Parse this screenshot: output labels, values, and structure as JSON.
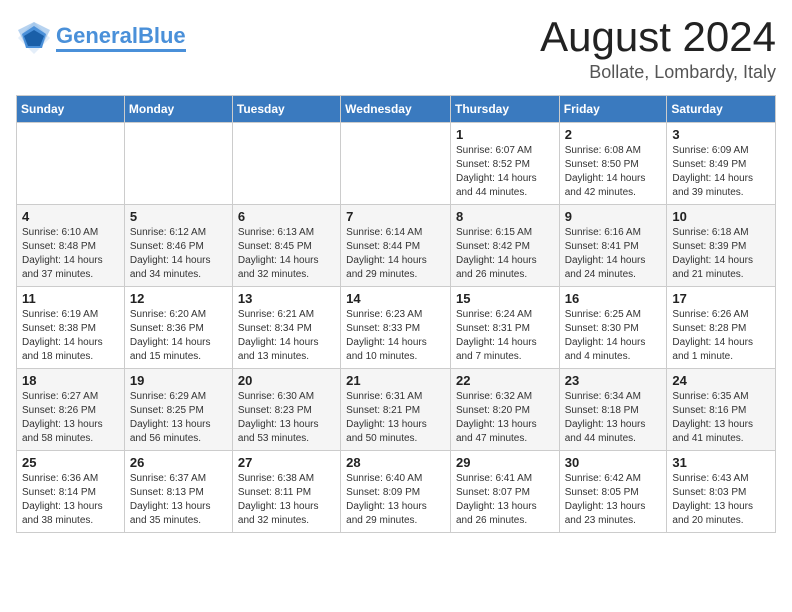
{
  "logo": {
    "part1": "General",
    "part2": "Blue"
  },
  "title": "August 2024",
  "location": "Bollate, Lombardy, Italy",
  "days_of_week": [
    "Sunday",
    "Monday",
    "Tuesday",
    "Wednesday",
    "Thursday",
    "Friday",
    "Saturday"
  ],
  "weeks": [
    [
      {
        "day": "",
        "info": ""
      },
      {
        "day": "",
        "info": ""
      },
      {
        "day": "",
        "info": ""
      },
      {
        "day": "",
        "info": ""
      },
      {
        "day": "1",
        "info": "Sunrise: 6:07 AM\nSunset: 8:52 PM\nDaylight: 14 hours\nand 44 minutes."
      },
      {
        "day": "2",
        "info": "Sunrise: 6:08 AM\nSunset: 8:50 PM\nDaylight: 14 hours\nand 42 minutes."
      },
      {
        "day": "3",
        "info": "Sunrise: 6:09 AM\nSunset: 8:49 PM\nDaylight: 14 hours\nand 39 minutes."
      }
    ],
    [
      {
        "day": "4",
        "info": "Sunrise: 6:10 AM\nSunset: 8:48 PM\nDaylight: 14 hours\nand 37 minutes."
      },
      {
        "day": "5",
        "info": "Sunrise: 6:12 AM\nSunset: 8:46 PM\nDaylight: 14 hours\nand 34 minutes."
      },
      {
        "day": "6",
        "info": "Sunrise: 6:13 AM\nSunset: 8:45 PM\nDaylight: 14 hours\nand 32 minutes."
      },
      {
        "day": "7",
        "info": "Sunrise: 6:14 AM\nSunset: 8:44 PM\nDaylight: 14 hours\nand 29 minutes."
      },
      {
        "day": "8",
        "info": "Sunrise: 6:15 AM\nSunset: 8:42 PM\nDaylight: 14 hours\nand 26 minutes."
      },
      {
        "day": "9",
        "info": "Sunrise: 6:16 AM\nSunset: 8:41 PM\nDaylight: 14 hours\nand 24 minutes."
      },
      {
        "day": "10",
        "info": "Sunrise: 6:18 AM\nSunset: 8:39 PM\nDaylight: 14 hours\nand 21 minutes."
      }
    ],
    [
      {
        "day": "11",
        "info": "Sunrise: 6:19 AM\nSunset: 8:38 PM\nDaylight: 14 hours\nand 18 minutes."
      },
      {
        "day": "12",
        "info": "Sunrise: 6:20 AM\nSunset: 8:36 PM\nDaylight: 14 hours\nand 15 minutes."
      },
      {
        "day": "13",
        "info": "Sunrise: 6:21 AM\nSunset: 8:34 PM\nDaylight: 14 hours\nand 13 minutes."
      },
      {
        "day": "14",
        "info": "Sunrise: 6:23 AM\nSunset: 8:33 PM\nDaylight: 14 hours\nand 10 minutes."
      },
      {
        "day": "15",
        "info": "Sunrise: 6:24 AM\nSunset: 8:31 PM\nDaylight: 14 hours\nand 7 minutes."
      },
      {
        "day": "16",
        "info": "Sunrise: 6:25 AM\nSunset: 8:30 PM\nDaylight: 14 hours\nand 4 minutes."
      },
      {
        "day": "17",
        "info": "Sunrise: 6:26 AM\nSunset: 8:28 PM\nDaylight: 14 hours\nand 1 minute."
      }
    ],
    [
      {
        "day": "18",
        "info": "Sunrise: 6:27 AM\nSunset: 8:26 PM\nDaylight: 13 hours\nand 58 minutes."
      },
      {
        "day": "19",
        "info": "Sunrise: 6:29 AM\nSunset: 8:25 PM\nDaylight: 13 hours\nand 56 minutes."
      },
      {
        "day": "20",
        "info": "Sunrise: 6:30 AM\nSunset: 8:23 PM\nDaylight: 13 hours\nand 53 minutes."
      },
      {
        "day": "21",
        "info": "Sunrise: 6:31 AM\nSunset: 8:21 PM\nDaylight: 13 hours\nand 50 minutes."
      },
      {
        "day": "22",
        "info": "Sunrise: 6:32 AM\nSunset: 8:20 PM\nDaylight: 13 hours\nand 47 minutes."
      },
      {
        "day": "23",
        "info": "Sunrise: 6:34 AM\nSunset: 8:18 PM\nDaylight: 13 hours\nand 44 minutes."
      },
      {
        "day": "24",
        "info": "Sunrise: 6:35 AM\nSunset: 8:16 PM\nDaylight: 13 hours\nand 41 minutes."
      }
    ],
    [
      {
        "day": "25",
        "info": "Sunrise: 6:36 AM\nSunset: 8:14 PM\nDaylight: 13 hours\nand 38 minutes."
      },
      {
        "day": "26",
        "info": "Sunrise: 6:37 AM\nSunset: 8:13 PM\nDaylight: 13 hours\nand 35 minutes."
      },
      {
        "day": "27",
        "info": "Sunrise: 6:38 AM\nSunset: 8:11 PM\nDaylight: 13 hours\nand 32 minutes."
      },
      {
        "day": "28",
        "info": "Sunrise: 6:40 AM\nSunset: 8:09 PM\nDaylight: 13 hours\nand 29 minutes."
      },
      {
        "day": "29",
        "info": "Sunrise: 6:41 AM\nSunset: 8:07 PM\nDaylight: 13 hours\nand 26 minutes."
      },
      {
        "day": "30",
        "info": "Sunrise: 6:42 AM\nSunset: 8:05 PM\nDaylight: 13 hours\nand 23 minutes."
      },
      {
        "day": "31",
        "info": "Sunrise: 6:43 AM\nSunset: 8:03 PM\nDaylight: 13 hours\nand 20 minutes."
      }
    ]
  ]
}
